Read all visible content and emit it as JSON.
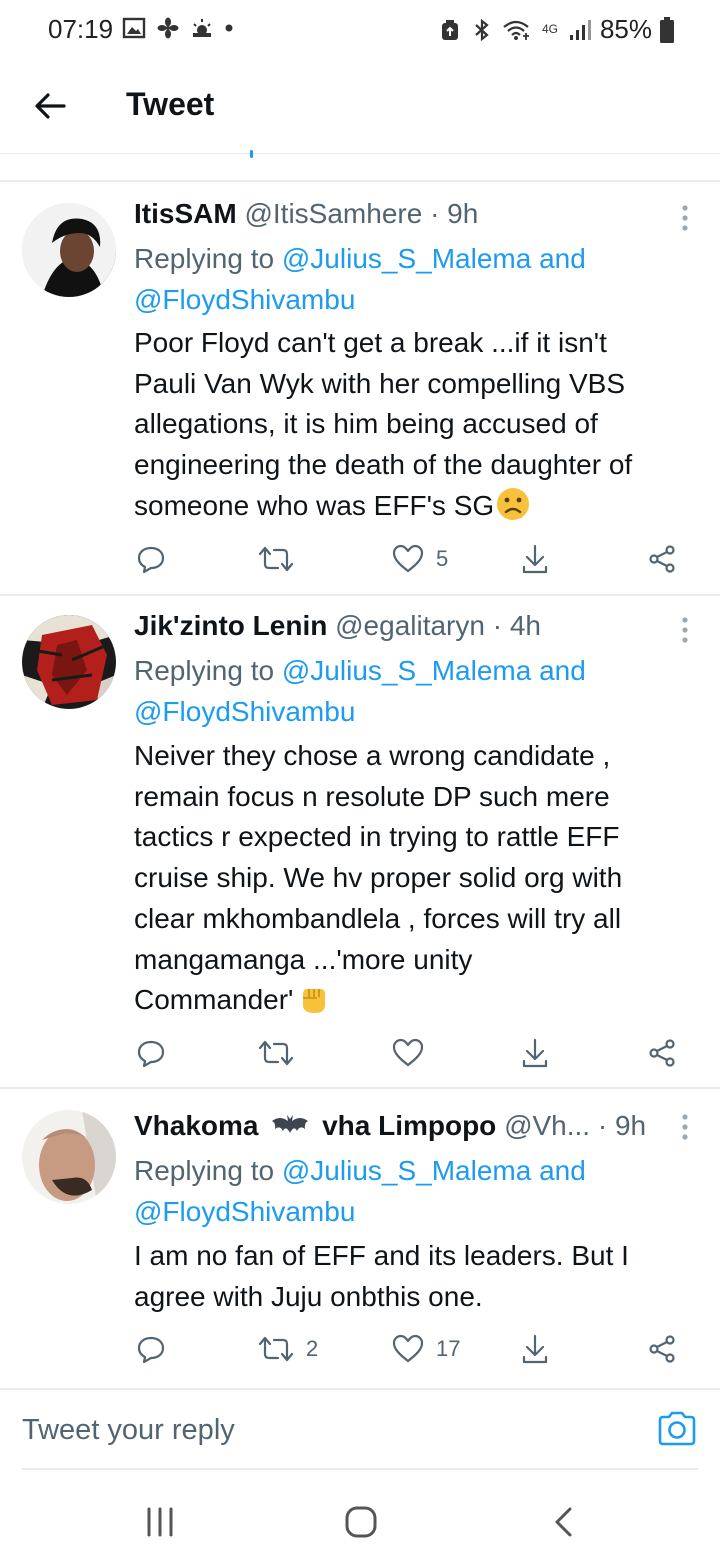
{
  "status_bar": {
    "time": "07:19",
    "battery": "85%",
    "network": "4G"
  },
  "header": {
    "title": "Tweet"
  },
  "tweets": [
    {
      "name": "ItisSAM",
      "handle": "@ItisSamhere",
      "time": "· 9h",
      "replying_prefix": "Replying to",
      "replying_to_1": "@Julius_S_Malema and",
      "replying_to_2": "@FloydShivambu",
      "text_lines": [
        "Poor Floyd can't get a break ...if it isn't",
        "Pauli Van Wyk with her compelling VBS",
        "allegations, it is him being accused of",
        "engineering the death of the daughter of",
        "someone who was EFF's SG"
      ],
      "emoji": "confused-face-emoji",
      "retweets": "",
      "likes": "5"
    },
    {
      "name": "Jik'zinto Lenin",
      "handle": "@egalitaryn",
      "time": "· 4h",
      "replying_prefix": "Replying to",
      "replying_to_1": "@Julius_S_Malema and",
      "replying_to_2": "@FloydShivambu",
      "text_lines": [
        "Neiver they chose a wrong candidate ,",
        "remain focus n resolute DP such mere",
        "tactics r expected in trying to rattle EFF",
        "cruise ship. We hv proper solid org with",
        "clear mkhombandlela , forces will try all",
        "mangamanga ...'more unity",
        "Commander'"
      ],
      "emoji": "raised-fist-emoji",
      "retweets": "",
      "likes": ""
    },
    {
      "name_part1": "Vhakoma",
      "name_part2": "vha Limpopo",
      "handle": "@Vh...",
      "time": "· 9h",
      "replying_prefix": "Replying to",
      "replying_to_1": "@Julius_S_Malema and",
      "replying_to_2": "@FloydShivambu",
      "text_lines": [
        "I am no fan of EFF and its leaders. But I",
        "agree with Juju onbthis one."
      ],
      "retweets": "2",
      "likes": "17"
    }
  ],
  "reply_bar": {
    "placeholder": "Tweet your reply"
  },
  "colors": {
    "accent": "#1d9bf0",
    "text": "#0f1419",
    "secondary": "#536471",
    "divider": "#e6ecf0"
  }
}
